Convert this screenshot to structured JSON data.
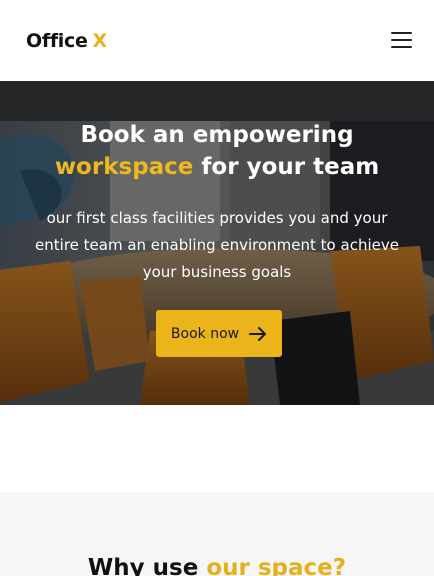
{
  "brand": {
    "name": "Office",
    "accent": "X",
    "accent_color": "#e5b020"
  },
  "header": {
    "menu_icon": "hamburger-menu-icon"
  },
  "hero": {
    "title_line1": "Book an empowering",
    "title_highlight": "workspace",
    "title_rest": " for your team",
    "subtitle": "our first class facilities provides you and your entire team an enabling environment to achieve your business goals",
    "cta_label": "Book now",
    "cta_icon": "arrow-right-icon",
    "background": "meeting-room-photo"
  },
  "why": {
    "title_plain": "Why use ",
    "title_highlight": "our space?"
  }
}
